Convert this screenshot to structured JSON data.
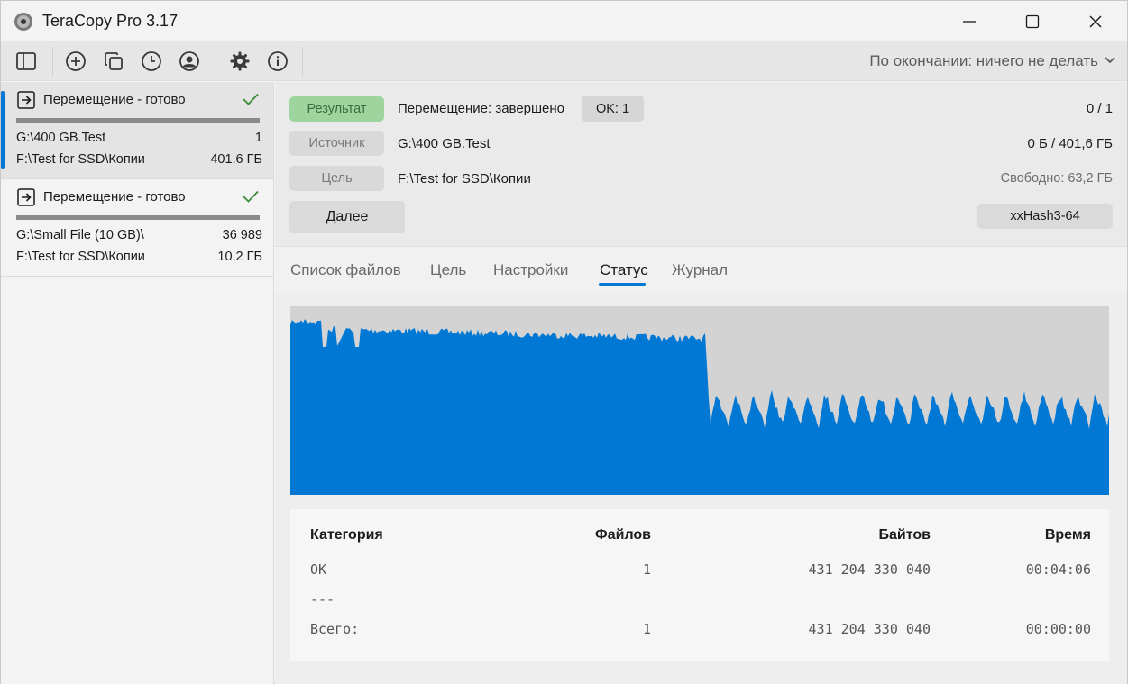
{
  "window": {
    "title": "TeraCopy Pro 3.17"
  },
  "toolbar": {
    "icons": [
      "sidebar-toggle-icon",
      "add-icon",
      "copy-icon",
      "history-icon",
      "account-icon",
      "gear-icon",
      "info-icon"
    ],
    "on_complete": "По окончании: ничего не делать"
  },
  "jobs": [
    {
      "title": "Перемещение - готово",
      "source": "G:\\400 GB.Test",
      "source_value": "1",
      "target": "F:\\Test for SSD\\Копии",
      "target_value": "401,6 ГБ",
      "progress": 1.0
    },
    {
      "title": "Перемещение - готово",
      "source": "G:\\Small File (10 GB)\\",
      "source_value": "36 989",
      "target": "F:\\Test for SSD\\Копии",
      "target_value": "10,2 ГБ",
      "progress": 1.0
    }
  ],
  "info": {
    "result_label": "Результат",
    "result_value": "Перемещение: завершено",
    "ok_badge": "OK: 1",
    "count": "0 / 1",
    "source_label": "Источник",
    "source_value": "G:\\400 GB.Test",
    "size": "0 Б / 401,6 ГБ",
    "target_label": "Цель",
    "target_value": "F:\\Test for SSD\\Копии",
    "free": "Свободно: 63,2 ГБ",
    "next_button": "Далее",
    "hash_button": "xxHash3-64"
  },
  "tabs": [
    {
      "label": "Список файлов"
    },
    {
      "label": "Цель"
    },
    {
      "label": "Настройки"
    },
    {
      "label": "Статус"
    },
    {
      "label": "Журнал"
    }
  ],
  "active_tab": "Статус",
  "stats": {
    "headers": {
      "category": "Категория",
      "files": "Файлов",
      "bytes": "Байтов",
      "time": "Время"
    },
    "rows": [
      {
        "category": "OK",
        "files": "1",
        "bytes": "431 204 330 040",
        "time": "00:04:06"
      },
      {
        "category": "---",
        "files": "",
        "bytes": "",
        "time": ""
      },
      {
        "category": "Всего:",
        "files": "1",
        "bytes": "431 204 330 040",
        "time": "00:00:00"
      }
    ]
  },
  "colors": {
    "accent": "#0078d4",
    "result_tag": "#9ed49e",
    "check": "#3a8a3a",
    "graph_bg": "#d3d3d3"
  }
}
